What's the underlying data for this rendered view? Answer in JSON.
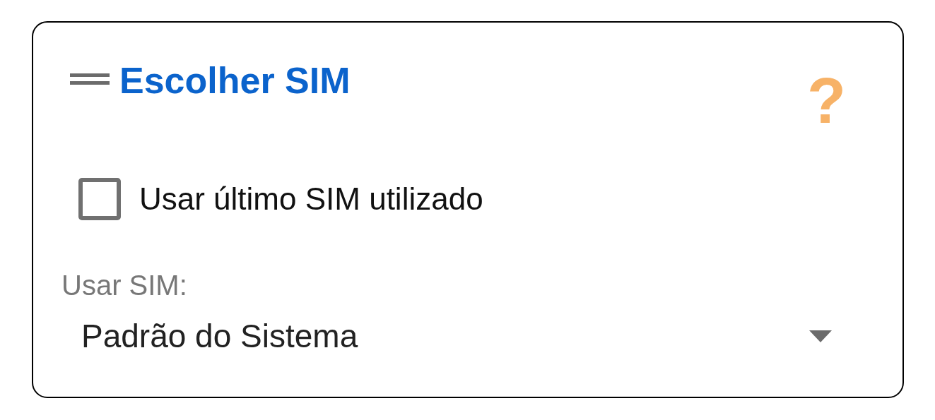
{
  "header": {
    "title": "Escolher SIM",
    "help": "?"
  },
  "option": {
    "label": "Usar último SIM utilizado",
    "checked": false
  },
  "sim": {
    "label": "Usar SIM:",
    "value": "Padrão do Sistema"
  }
}
